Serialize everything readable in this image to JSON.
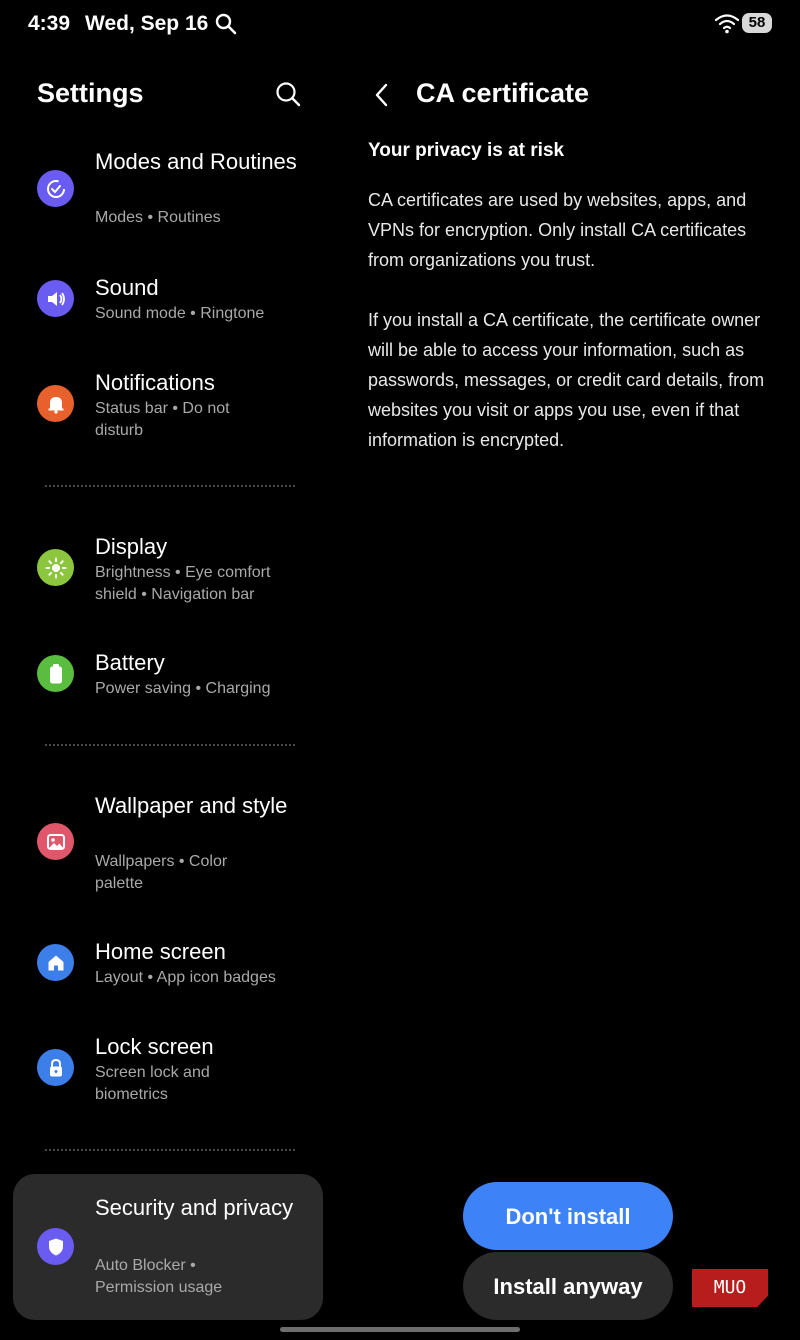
{
  "status_bar": {
    "time": "4:39",
    "date": "Wed, Sep 16",
    "battery": "58"
  },
  "settings": {
    "title": "Settings",
    "items": [
      {
        "title": "Modes and Routines",
        "subtitle": "Modes  •  Routines",
        "color": "#6a5cf0",
        "icon": "modes-icon"
      },
      {
        "title": "Sound",
        "subtitle": "Sound mode  •  Ringtone",
        "color": "#6a5cf0",
        "icon": "speaker-icon"
      },
      {
        "title": "Notifications",
        "subtitle": "Status bar  •  Do not disturb",
        "color": "#e8612c",
        "icon": "bell-icon"
      },
      {
        "title": "Display",
        "subtitle": "Brightness  •  Eye comfort shield  •  Navigation bar",
        "color": "#8cc63f",
        "icon": "sun-icon"
      },
      {
        "title": "Battery",
        "subtitle": "Power saving  •  Charging",
        "color": "#5bbd3f",
        "icon": "battery-icon"
      },
      {
        "title": "Wallpaper and style",
        "subtitle": "Wallpapers  •  Color palette",
        "color": "#e0566b",
        "icon": "image-icon"
      },
      {
        "title": "Home screen",
        "subtitle": "Layout  •  App icon badges",
        "color": "#3d7fe8",
        "icon": "home-icon"
      },
      {
        "title": "Lock screen",
        "subtitle": "Screen lock and biometrics",
        "color": "#3d7fe8",
        "icon": "lock-icon"
      },
      {
        "title": "Security and privacy",
        "subtitle": "Auto Blocker  •  Permission usage",
        "color": "#6a5cf0",
        "icon": "shield-icon"
      }
    ]
  },
  "certificate": {
    "title": "CA certificate",
    "heading": "Your privacy is at risk",
    "paragraph1": "CA certificates are used by websites, apps, and VPNs for encryption. Only install CA certificates from organizations you trust.",
    "paragraph2": "If you install a CA certificate, the certificate owner will be able to access your information, such as passwords, messages, or credit card details, from websites you visit or apps you use, even if that information is encrypted.",
    "primary_button": "Don't install",
    "secondary_button": "Install anyway"
  },
  "watermark": "MUO"
}
